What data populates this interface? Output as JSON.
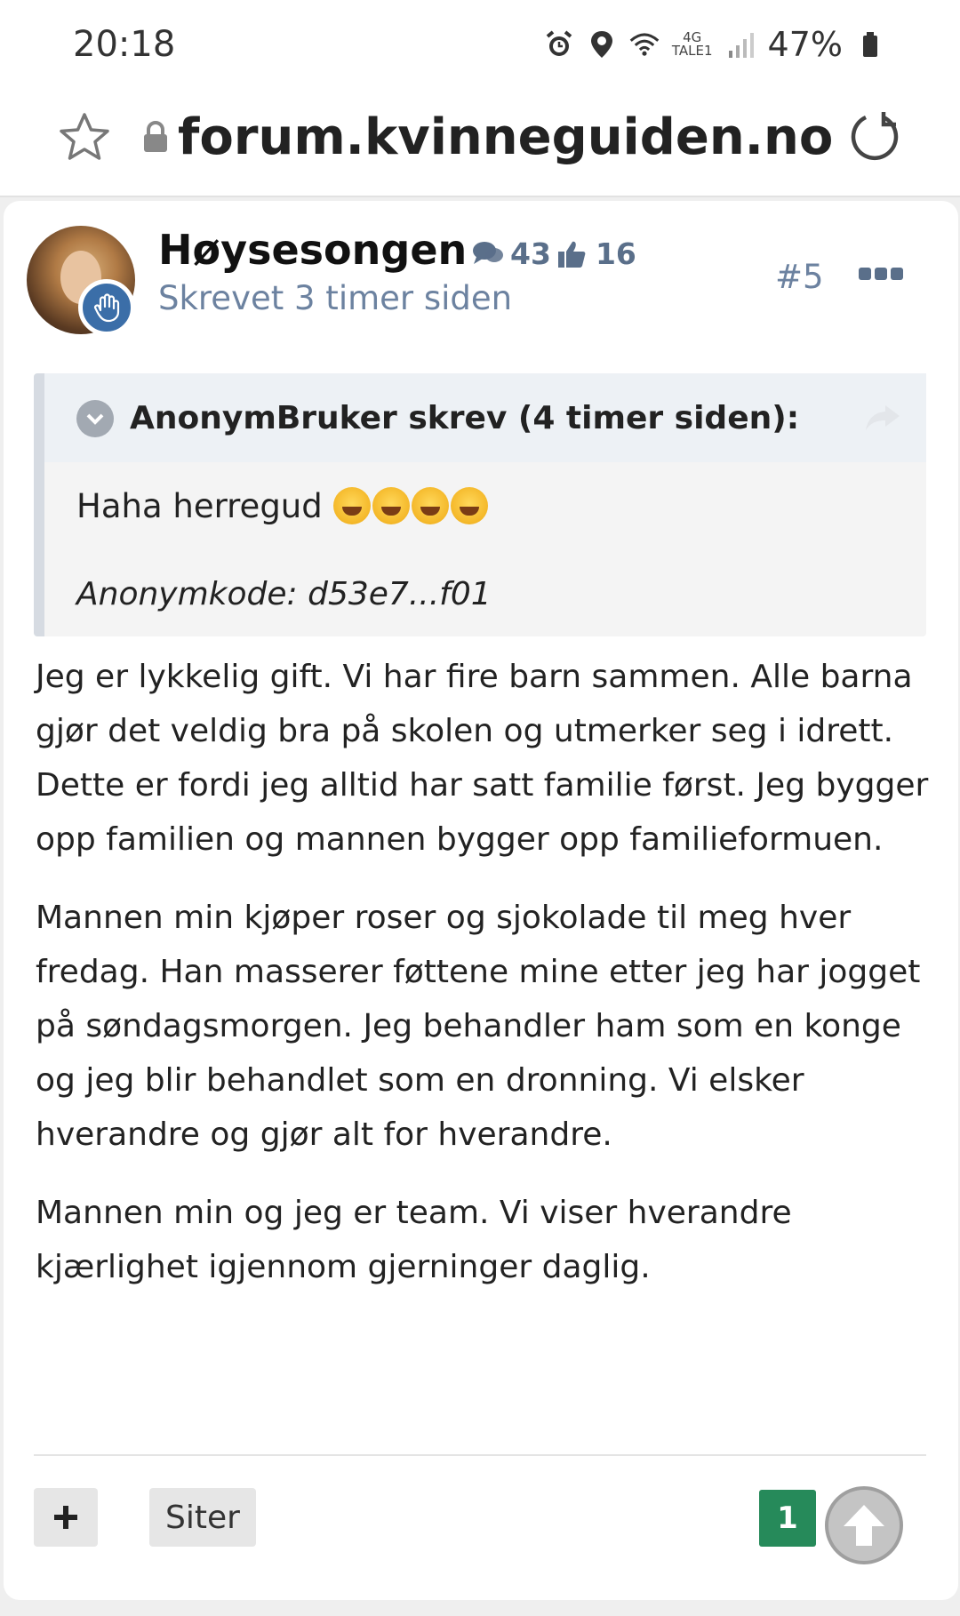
{
  "status_bar": {
    "time": "20:18",
    "network_top": "4G",
    "network_bottom": "TALE1",
    "battery": "47%",
    "icons": [
      "alarm-icon",
      "location-icon",
      "wifi-icon",
      "signal-icon",
      "battery-icon"
    ]
  },
  "browser": {
    "url": "forum.kvinneguiden.no",
    "icons": [
      "star-icon",
      "lock-icon",
      "reload-icon"
    ]
  },
  "post": {
    "author": "Høysesongen",
    "comment_count": "43",
    "reputation": "16",
    "posted": "Skrevet 3 timer siden",
    "post_number": "#5",
    "quote": {
      "header": "AnonymBruker skrev (4 timer siden):",
      "text": "Haha herregud",
      "emoji_count": 4,
      "code": "Anonymkode: d53e7...f01"
    },
    "paragraphs": [
      "Jeg er lykkelig gift. Vi har fire barn sammen. Alle barna gjør det veldig bra på skolen og utmerker seg i idrett. Dette er fordi jeg alltid har satt familie først. Jeg bygger opp familien og mannen bygger opp familieformuen.",
      "Mannen min kjøper roser og sjokolade til meg hver fredag. Han masserer føttene mine etter jeg har jogget på søndagsmorgen. Jeg behandler ham som en konge og jeg blir behandlet som en dronning. Vi elsker hverandre og gjør alt for hverandre.",
      "Mannen min og jeg er team. Vi viser hverandre kjærlighet igjennom gjerninger daglig."
    ],
    "actions": {
      "quote_label": "Siter",
      "like_count": "1"
    }
  },
  "colors": {
    "accent_blue": "#6c82a0",
    "like_green": "#268a5a",
    "badge_blue": "#3b6ea8"
  }
}
